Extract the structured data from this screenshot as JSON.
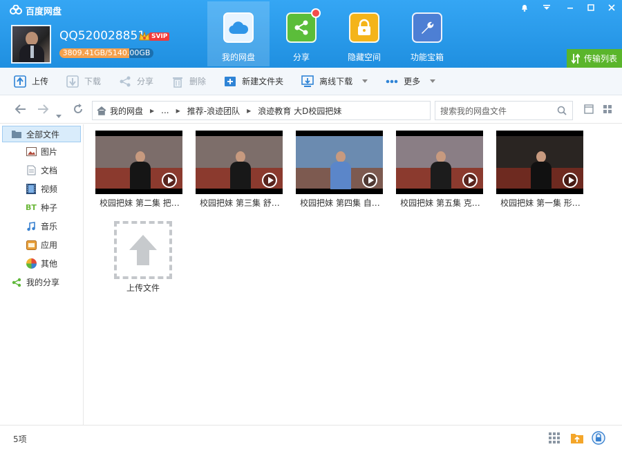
{
  "app": {
    "title": "百度网盘"
  },
  "user": {
    "name": "QQ520028851",
    "vip_badge": "SVIP",
    "quota_text": "3809.41GB/5140.00GB",
    "quota_fraction": 0.741
  },
  "nav_tabs": [
    {
      "label": "我的网盘",
      "icon": "cloud-icon",
      "active": true
    },
    {
      "label": "分享",
      "icon": "share-icon",
      "active": false
    },
    {
      "label": "隐藏空间",
      "icon": "lock-icon",
      "active": false
    },
    {
      "label": "功能宝箱",
      "icon": "wrench-icon",
      "active": false
    }
  ],
  "transfer": {
    "label": "传输列表"
  },
  "toolbar": {
    "upload": "上传",
    "download": "下载",
    "share": "分享",
    "delete": "删除",
    "new_folder": "新建文件夹",
    "offline_download": "离线下载",
    "more": "更多"
  },
  "breadcrumb": {
    "root": "我的网盘",
    "ellipsis": "...",
    "level1": "推荐-浪迹团队",
    "level2": "浪迹教育 大D校园把妹"
  },
  "search": {
    "placeholder": "搜索我的网盘文件"
  },
  "sidebar": {
    "items": [
      {
        "label": "全部文件",
        "icon": "folder-icon"
      },
      {
        "label": "图片",
        "icon": "picture-icon"
      },
      {
        "label": "文档",
        "icon": "document-icon"
      },
      {
        "label": "视频",
        "icon": "video-icon"
      },
      {
        "label": "种子",
        "icon": "bt-icon"
      },
      {
        "label": "音乐",
        "icon": "music-icon"
      },
      {
        "label": "应用",
        "icon": "app-icon"
      },
      {
        "label": "其他",
        "icon": "other-icon"
      },
      {
        "label": "我的分享",
        "icon": "share-icon"
      }
    ]
  },
  "files": [
    {
      "name": "校园把妹 第二集 把…",
      "bg": "#7c6d6a",
      "shirt": "#151515"
    },
    {
      "name": "校园把妹 第三集 舒…",
      "bg": "#7d6e6a",
      "shirt": "#181818"
    },
    {
      "name": "校园把妹 第四集 自…",
      "bg": "#6b8bb0",
      "shirt": "#5b86c9"
    },
    {
      "name": "校园把妹 第五集 克…",
      "bg": "#8a7e85",
      "shirt": "#1c1c1c"
    },
    {
      "name": "校园把妹 第一集 形…",
      "bg": "#2a2522",
      "shirt": "#111111"
    }
  ],
  "upload_tile": {
    "label": "上传文件"
  },
  "status": {
    "count": "5项"
  }
}
